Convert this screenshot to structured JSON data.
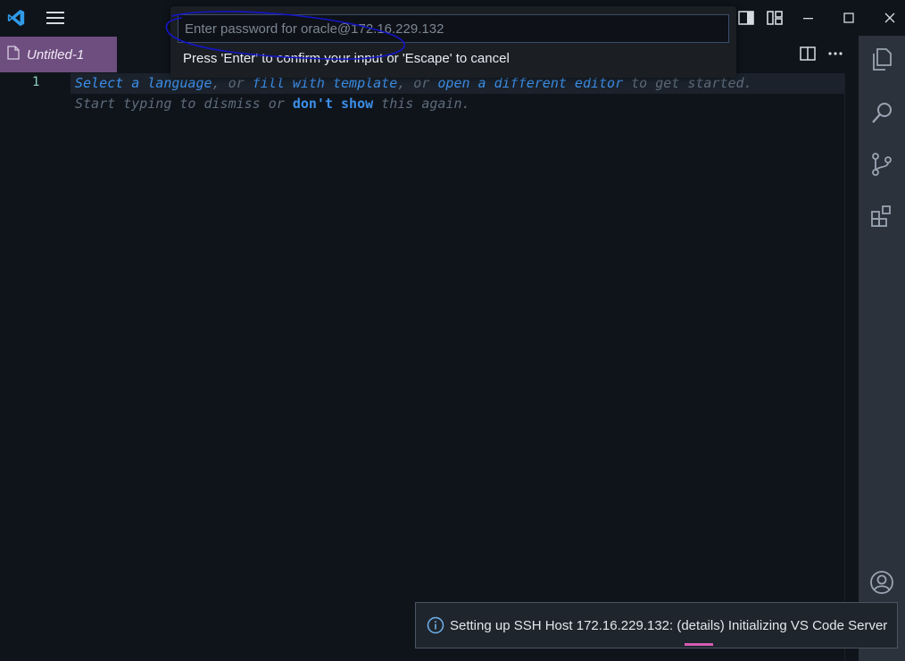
{
  "titlebar": {
    "menu_icon": "hamburger-icon",
    "layout_icons": [
      "toggle-secondary-sidebar-icon",
      "customize-layout-icon"
    ],
    "window_controls": [
      "minimize-icon",
      "maximize-icon",
      "close-icon"
    ]
  },
  "quickpick": {
    "placeholder": "Enter password for oracle@172.16.229.132",
    "value": "",
    "message": "Press 'Enter' to confirm your input or 'Escape' to cancel",
    "annotation_color": "#1515c8"
  },
  "tabs": [
    {
      "label": "Untitled-1",
      "icon": "file-icon",
      "active": true
    }
  ],
  "editor_actions": [
    "split-editor-icon",
    "more-actions-icon"
  ],
  "editor": {
    "line_number": "1",
    "hint_line1": {
      "select_language": "Select a language",
      "sep1": ", or ",
      "fill_template": "fill with template",
      "sep2": ", or ",
      "open_editor": "open a different editor",
      "tail": " to get started."
    },
    "hint_line2": {
      "start": "Start typing to dismiss or ",
      "dont_show": "don't show",
      "tail": " this again."
    }
  },
  "activity_bar": {
    "items": [
      "explorer-icon",
      "search-icon",
      "source-control-icon",
      "extensions-icon"
    ],
    "bottom": [
      "accounts-icon"
    ]
  },
  "notification": {
    "icon": "info-icon",
    "text": "Setting up SSH Host 172.16.229.132: (details) Initializing VS Code Server"
  },
  "colors": {
    "background": "#0f141b",
    "tab_active": "#6e4d7f",
    "activity_bar": "#2b323c",
    "link": "#3c8fe8",
    "progress": "#d45bb3"
  }
}
